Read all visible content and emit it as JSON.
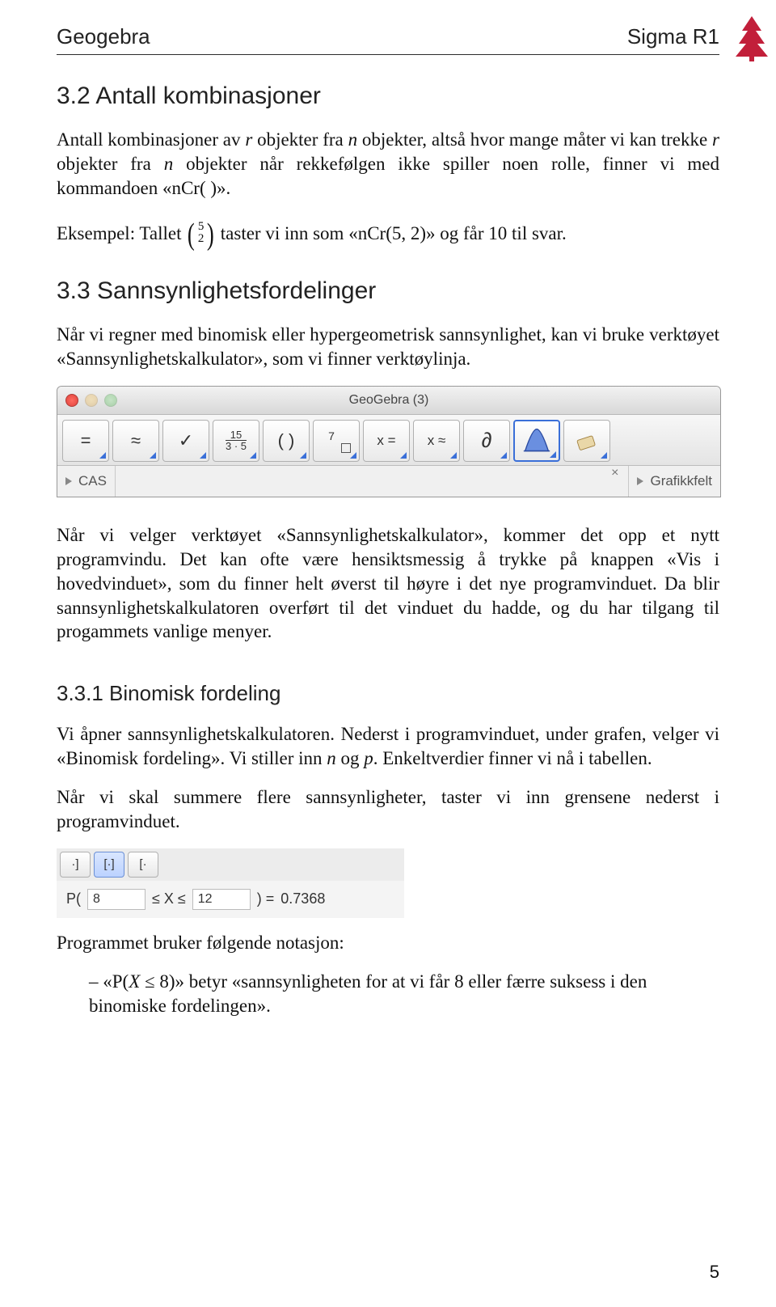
{
  "header": {
    "left": "Geogebra",
    "right": "Sigma R1"
  },
  "sec32": {
    "title": "3.2   Antall kombinasjoner",
    "p1_a": "Antall kombinasjoner av ",
    "p1_r": "r",
    "p1_b": " objekter fra ",
    "p1_n": "n",
    "p1_c": " objekter, altså hvor mange måter vi kan trekke ",
    "p1_r2": "r",
    "p1_d": " objekter fra ",
    "p1_n2": "n",
    "p1_e": " objekter når rekkefølgen ikke spiller noen rolle, finner vi med kommandoen «nCr( )».",
    "ex_a": "Eksempel: Tallet ",
    "binom_top": "5",
    "binom_bot": "2",
    "ex_b": " taster vi inn som «nCr(5, 2)» og får 10 til svar."
  },
  "sec33": {
    "title": "3.3   Sannsynlighetsfordelinger",
    "p1": "Når vi regner med binomisk eller hypergeometrisk sannsynlighet, kan vi bruke verktøyet «Sannsynlighetskalkulator», som vi finner verktøylinja."
  },
  "gg": {
    "title": "GeoGebra (3)",
    "panel_left": "CAS",
    "panel_right": "Grafikkfelt",
    "tool_eq": "=",
    "tool_approx": "≈",
    "tool_check": "✓",
    "tool_frac_top": "15",
    "tool_frac_bot": "3 · 5",
    "tool_paren": "( )",
    "tool_seven": "7",
    "tool_xeq": "x =",
    "tool_xapprox": "x ≈",
    "tool_partial": "∂"
  },
  "para2": "Når vi velger verktøyet «Sannsynlighetskalkulator», kommer det opp et nytt programvindu. Det kan ofte være hensiktsmessig å trykke på knappen «Vis i hovedvinduet», som du finner helt øverst til høyre i det nye programvinduet. Da blir sannsynlighetskalkulatoren overført til det vinduet du hadde, og du har tilgang til progammets vanlige menyer.",
  "sec331": {
    "title": "3.3.1   Binomisk fordeling",
    "p1_a": "Vi åpner sannsynlighetskalkulatoren. Nederst i programvinduet, under grafen, velger vi «Binomisk fordeling». Vi stiller inn ",
    "p1_n": "n",
    "p1_b": " og ",
    "p1_p": "p",
    "p1_c": ". Enkeltverdier finner vi nå i tabellen.",
    "p2": "Når vi skal summere flere sannsynligheter, taster vi inn grensene nederst i programvinduet."
  },
  "prob": {
    "btn1": "·]",
    "btn2": "[·]",
    "btn3": "[·",
    "label_P": "P(",
    "low": "8",
    "mid": "≤ X ≤",
    "high": "12",
    "close": ")  =",
    "result": "0.7368"
  },
  "after_prob": "Programmet bruker følgende notasjon:",
  "bullet_a": "«P(",
  "bullet_X": "X",
  "bullet_le": " ≤ 8)» betyr «sannsynligheten for at vi får 8 eller færre suksess i den binomiske fordelingen».",
  "pageno": "5"
}
